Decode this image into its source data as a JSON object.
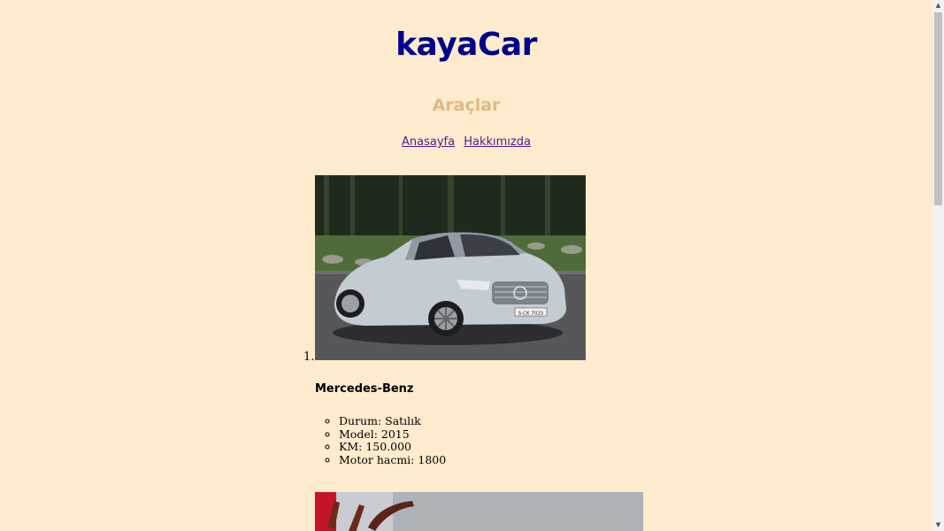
{
  "header": {
    "site_title": "kayaCar",
    "section_title": "Araçlar"
  },
  "nav": {
    "links": [
      "Anasayfa",
      "Hakkımızda"
    ]
  },
  "cars": [
    {
      "number": "1.",
      "name": "Mercedes-Benz",
      "specs": [
        "Durum: Satılık",
        "Model: 2015",
        "KM: 150.000",
        "Motor hacmi: 1800"
      ],
      "plate_text": "S-CK 7025"
    }
  ],
  "colors": {
    "background": "#ffebcd",
    "site_title": "#00008b",
    "section_title": "#deb887",
    "link": "#551a8b"
  },
  "icons": {
    "scroll_up": "scroll-up-arrow-icon",
    "scroll_down": "scroll-down-arrow-icon"
  }
}
